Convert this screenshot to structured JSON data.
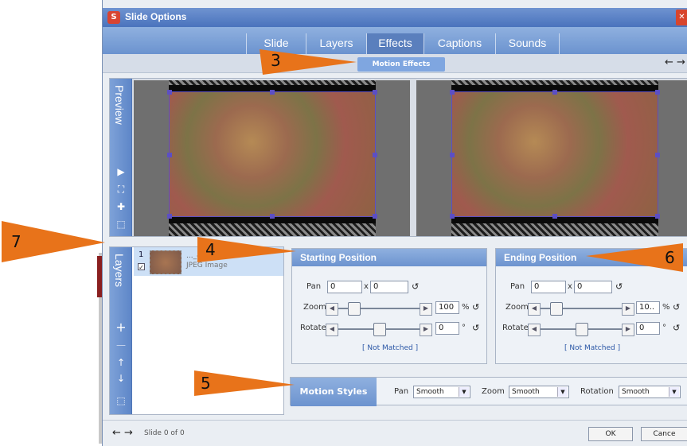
{
  "window": {
    "title": "Slide Options",
    "close_icon": "close-icon"
  },
  "tabs": [
    {
      "label": "Slide"
    },
    {
      "label": "Layers"
    },
    {
      "label": "Effects"
    },
    {
      "label": "Captions"
    },
    {
      "label": "Sounds"
    }
  ],
  "active_tab": "Effects",
  "subtab": {
    "label": "Motion Effects"
  },
  "subnav": {
    "arrows": "← →"
  },
  "preview": {
    "label": "Preview",
    "buttons": [
      "play-icon",
      "fit-icon",
      "zoom-icon",
      "select-icon"
    ]
  },
  "layers": {
    "label": "Layers",
    "item": {
      "number": "1",
      "check": "✓",
      "name": "..._4",
      "type": "JPEG Image"
    },
    "buttons": [
      "add-icon",
      "remove-icon",
      "move-up-icon",
      "move-down-icon",
      "edit-icon"
    ]
  },
  "starting_position": {
    "title": "Starting Position",
    "pan_label": "Pan",
    "pan_x": "0",
    "pan_sep": "x",
    "pan_y": "0",
    "zoom_label": "Zoom",
    "zoom_value": "100",
    "zoom_unit": "%",
    "rotate_label": "Rotate",
    "rotate_value": "0",
    "rotate_unit": "°",
    "matched": "[ Not Matched ]"
  },
  "ending_position": {
    "title": "Ending Position",
    "pan_label": "Pan",
    "pan_x": "0",
    "pan_sep": "x",
    "pan_y": "0",
    "zoom_label": "Zoom",
    "zoom_value": "10..",
    "zoom_unit": "%",
    "rotate_label": "Rotate",
    "rotate_value": "0",
    "rotate_unit": "°",
    "matched": "[ Not Matched ]"
  },
  "motion_styles": {
    "title": "Motion Styles",
    "pan_label": "Pan",
    "pan_value": "Smooth",
    "zoom_label": "Zoom",
    "zoom_value": "Smooth",
    "rotation_label": "Rotation",
    "rotation_value": "Smooth"
  },
  "footer": {
    "nav": "← →",
    "slide_info": "Slide 0 of 0",
    "ok": "OK",
    "cancel": "Cance"
  },
  "annotations": [
    "3",
    "4",
    "5",
    "6",
    "7"
  ],
  "colors": {
    "accent": "#6c93cf",
    "arrow": "#e8731a",
    "selection": "#5c4fc4"
  }
}
